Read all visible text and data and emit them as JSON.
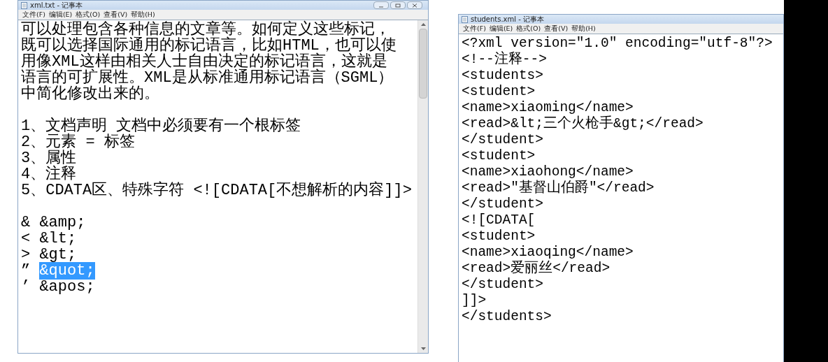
{
  "windows": [
    {
      "title": "xml.txt - 记事本",
      "menu": [
        "文件(F)",
        "编辑(E)",
        "格式(O)",
        "查看(V)",
        "帮助(H)"
      ],
      "controls": true,
      "scrollbar": true,
      "paragraphs": [
        [
          {
            "text": "可以处理包含各种信息的文章等。如何定义这些标记，"
          },
          {
            "text": "既可以选择国际通用的标记语言，比如HTML，也可以使"
          },
          {
            "text": "用像XML这样由相关人士自由决定的标记语言，这就是"
          },
          {
            "text": "语言的可扩展性。XML是从标准通用标记语言（SGML）"
          },
          {
            "text": "中简化修改出来的。"
          }
        ],
        [
          {
            "text": "1、文档声明 文档中必须要有一个根标签"
          },
          {
            "text": "2、元素 = 标签"
          },
          {
            "text": "3、属性"
          },
          {
            "text": "4、注释"
          },
          {
            "text": "5、CDATA区、特殊字符 <![CDATA[不想解析的内容]]>"
          }
        ],
        [
          {
            "text": "& &amp;"
          },
          {
            "text": "< &lt;"
          },
          {
            "text": "> &gt;"
          },
          {
            "text": "” ",
            "selection": "&quot;"
          },
          {
            "text": "’ &apos;"
          }
        ]
      ]
    },
    {
      "title": "students.xml - 记事本",
      "menu": [
        "文件(F)",
        "编辑(E)",
        "格式(O)",
        "查看(V)",
        "帮助(H)"
      ],
      "controls": false,
      "scrollbar": false,
      "paragraphs": [
        [
          {
            "text": "<?xml version=\"1.0\" encoding=\"utf-8\"?>"
          },
          {
            "text": "<!--注释-->"
          },
          {
            "text": "<students>"
          },
          {
            "text": "<student>"
          },
          {
            "text": "<name>xiaoming</name>"
          },
          {
            "text": "<read>&lt;三个火枪手&gt;</read>"
          },
          {
            "text": "</student>"
          },
          {
            "text": "<student>"
          },
          {
            "text": "<name>xiaohong</name>"
          },
          {
            "text": "<read>\"基督山伯爵\"</read>"
          },
          {
            "text": "</student>"
          },
          {
            "text": "<![CDATA["
          },
          {
            "text": "<student>"
          },
          {
            "text": "<name>xiaoqing</name>"
          },
          {
            "text": "<read>爱丽丝</read>"
          },
          {
            "text": "</student>"
          },
          {
            "text": "]]>"
          },
          {
            "text": "</students>"
          }
        ]
      ]
    }
  ]
}
